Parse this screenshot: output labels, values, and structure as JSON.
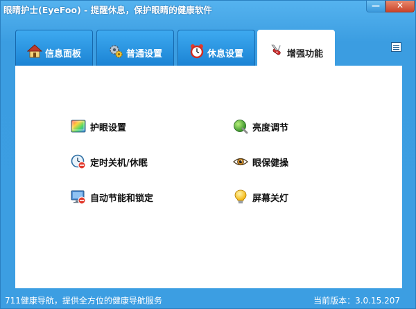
{
  "window": {
    "title": "眼睛护士(EyeFoo) - 提醒休息，保护眼睛的健康软件",
    "minimize_label": "—",
    "close_label": "✕"
  },
  "tabs": [
    {
      "label": "信息面板",
      "icon": "house-icon"
    },
    {
      "label": "普通设置",
      "icon": "gear-icon"
    },
    {
      "label": "休息设置",
      "icon": "alarm-clock-icon"
    },
    {
      "label": "增强功能",
      "icon": "swiss-knife-icon",
      "active": true
    }
  ],
  "features": {
    "left": [
      {
        "label": "护眼设置",
        "icon": "eye-settings-icon"
      },
      {
        "label": "定时关机/休眠",
        "icon": "timer-shutdown-icon"
      },
      {
        "label": "自动节能和锁定",
        "icon": "monitor-lock-icon"
      }
    ],
    "right": [
      {
        "label": "亮度调节",
        "icon": "brightness-knob-icon"
      },
      {
        "label": "眼保健操",
        "icon": "eye-icon"
      },
      {
        "label": "屏幕关灯",
        "icon": "lightbulb-icon"
      }
    ]
  },
  "footer": {
    "link_text": "711健康导航，提供全方位的健康导航服务",
    "version_text": "当前版本：3.0.15.207"
  }
}
